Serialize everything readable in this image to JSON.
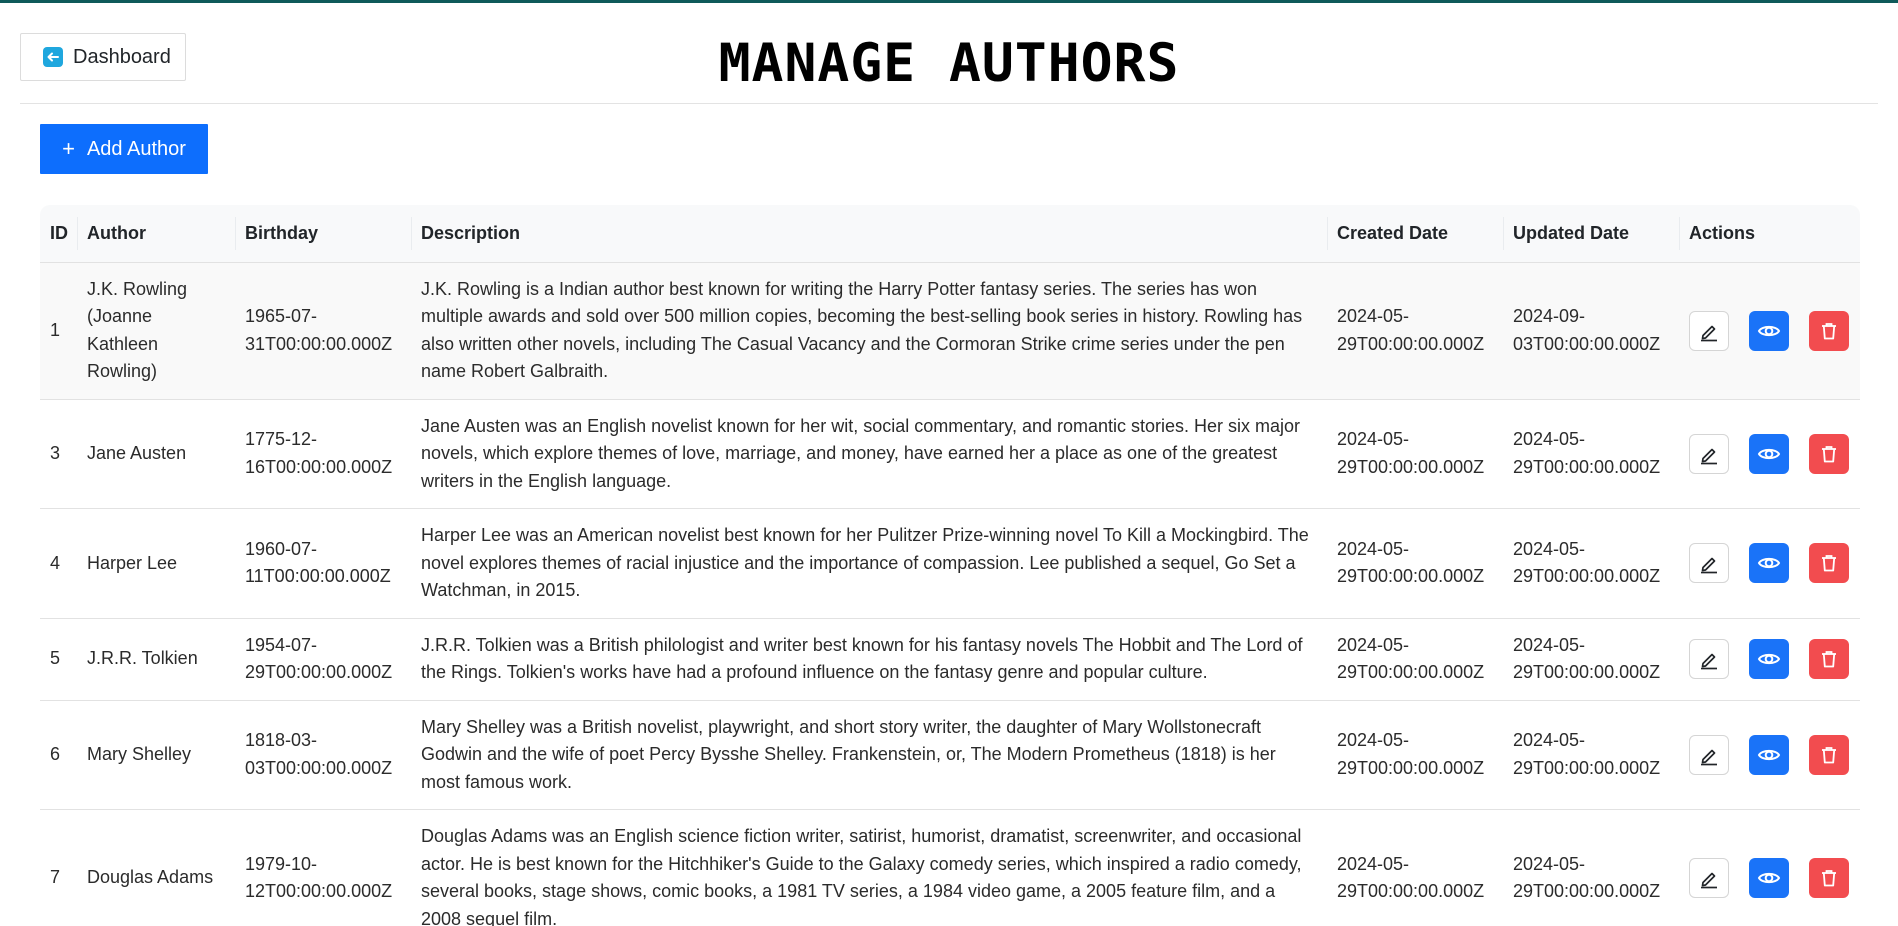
{
  "header": {
    "dashboard_label": "Dashboard",
    "title": "MANAGE AUTHORS",
    "add_label": "Add Author",
    "add_icon": "+"
  },
  "colors": {
    "primary": "#0d6efd",
    "view_button": "#1a73f8",
    "delete_button": "#f24c4f",
    "dashboard_icon": "#1fa7de"
  },
  "icons": {
    "edit": "pencil-icon",
    "view": "eye-icon",
    "delete": "trash-icon",
    "back": "arrow-left-icon"
  },
  "table": {
    "columns": [
      "ID",
      "Author",
      "Birthday",
      "Description",
      "Created Date",
      "Updated Date",
      "Actions"
    ],
    "rows": [
      {
        "id": "1",
        "author": "J.K. Rowling (Joanne Kathleen Rowling)",
        "birthday": "1965-07-31T00:00:00.000Z",
        "description": "J.K. Rowling is a Indian author best known for writing the Harry Potter fantasy series. The series has won multiple awards and sold over 500 million copies, becoming the best-selling book series in history. Rowling has also written other novels, including The Casual Vacancy and the Cormoran Strike crime series under the pen name Robert Galbraith.",
        "created": "2024-05-29T00:00:00.000Z",
        "updated": "2024-09-03T00:00:00.000Z"
      },
      {
        "id": "3",
        "author": "Jane Austen",
        "birthday": "1775-12-16T00:00:00.000Z",
        "description": "Jane Austen was an English novelist known for her wit, social commentary, and romantic stories. Her six major novels, which explore themes of love, marriage, and money, have earned her a place as one of the greatest writers in the English language.",
        "created": "2024-05-29T00:00:00.000Z",
        "updated": "2024-05-29T00:00:00.000Z"
      },
      {
        "id": "4",
        "author": "Harper Lee",
        "birthday": "1960-07-11T00:00:00.000Z",
        "description": "Harper Lee was an American novelist best known for her Pulitzer Prize-winning novel To Kill a Mockingbird. The novel explores themes of racial injustice and the importance of compassion. Lee published a sequel, Go Set a Watchman, in 2015.",
        "created": "2024-05-29T00:00:00.000Z",
        "updated": "2024-05-29T00:00:00.000Z"
      },
      {
        "id": "5",
        "author": "J.R.R. Tolkien",
        "birthday": "1954-07-29T00:00:00.000Z",
        "description": "J.R.R. Tolkien was a British philologist and writer best known for his fantasy novels The Hobbit and The Lord of the Rings. Tolkien's works have had a profound influence on the fantasy genre and popular culture.",
        "created": "2024-05-29T00:00:00.000Z",
        "updated": "2024-05-29T00:00:00.000Z"
      },
      {
        "id": "6",
        "author": "Mary Shelley",
        "birthday": "1818-03-03T00:00:00.000Z",
        "description": "Mary Shelley was a British novelist, playwright, and short story writer, the daughter of Mary Wollstonecraft Godwin and the wife of poet Percy Bysshe Shelley. Frankenstein, or, The Modern Prometheus (1818) is her most famous work.",
        "created": "2024-05-29T00:00:00.000Z",
        "updated": "2024-05-29T00:00:00.000Z"
      },
      {
        "id": "7",
        "author": "Douglas Adams",
        "birthday": "1979-10-12T00:00:00.000Z",
        "description": "Douglas Adams was an English science fiction writer, satirist, humorist, dramatist, screenwriter, and occasional actor. He is best known for the Hitchhiker's Guide to the Galaxy comedy series, which inspired a radio comedy, several books, stage shows, comic books, a 1981 TV series, a 1984 video game, a 2005 feature film, and a 2008 sequel film.",
        "created": "2024-05-29T00:00:00.000Z",
        "updated": "2024-05-29T00:00:00.000Z"
      }
    ]
  }
}
